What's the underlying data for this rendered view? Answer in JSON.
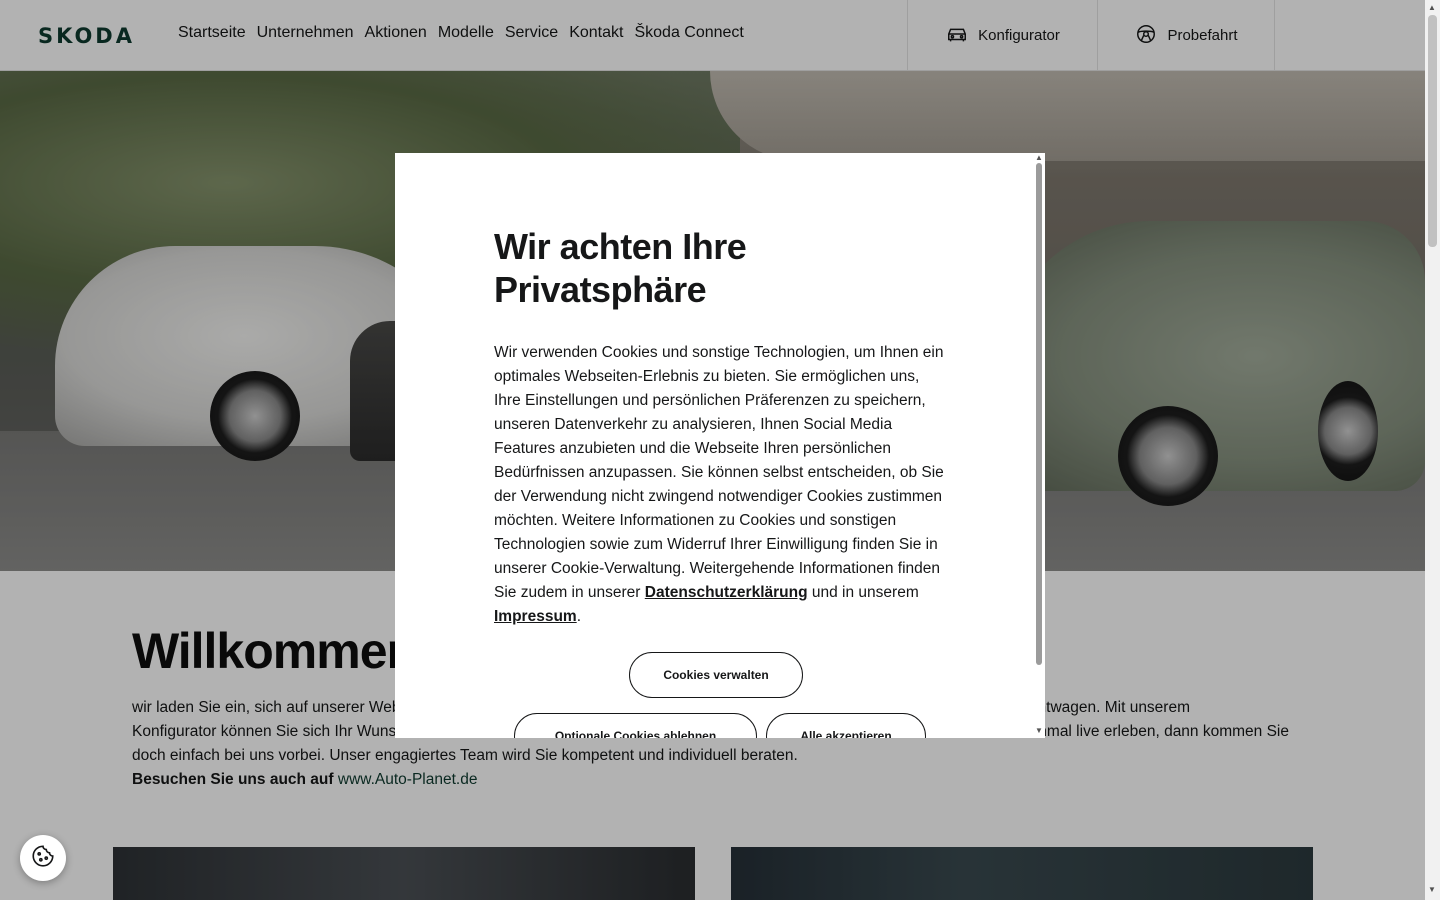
{
  "header": {
    "logo": "SKODA",
    "nav": [
      "Startseite",
      "Unternehmen",
      "Aktionen",
      "Modelle",
      "Service",
      "Kontakt",
      "Škoda Connect"
    ],
    "konfigurator_label": "Konfigurator",
    "probefahrt_label": "Probefahrt"
  },
  "main": {
    "welcome_title": "Willkommen",
    "intro_line1_start": "wir laden Sie ein, sich auf unserer Webs",
    "intro_line1_end": "uchtwagen. Mit unserem",
    "intro_line2_start": "Konfigurator können Sie sich Ihr Wunsc",
    "intro_line2_end": "nmal live erleben, dann kommen Sie",
    "intro_line3": "doch einfach bei uns vorbei. Unser engagiertes Team wird Sie kompetent und individuell beraten.",
    "visit_label": "Besuchen Sie uns auch auf",
    "visit_link": "www.Auto-Planet.de"
  },
  "cookie_modal": {
    "title": "Wir achten Ihre Privatsphäre",
    "body": "Wir verwenden Cookies und sonstige Technologien, um Ihnen ein optimales Webseiten-Erlebnis zu bieten. Sie ermöglichen uns, Ihre Einstellungen und persönlichen Präferenzen zu speichern, unseren Datenverkehr zu analysieren, Ihnen Social Media Features anzubieten und die Webseite Ihren persönlichen Bedürfnissen anzupassen. Sie können selbst entscheiden, ob Sie der Verwendung nicht zwingend notwendiger Cookies zustimmen möchten. Weitere Informationen zu Cookies und sonstigen Technologien sowie zum Widerruf Ihrer Einwilligung finden Sie in unserer Cookie-Verwaltung. Weitergehende Informationen finden Sie zudem in unserer",
    "privacy_link": "Datenschutzerklärung",
    "and_text": "und in unserem",
    "imprint_link": "Impressum",
    "period": ".",
    "manage_button": "Cookies verwalten",
    "reject_button": "Optionale Cookies ablehnen",
    "accept_button": "Alle akzeptieren"
  },
  "colors": {
    "brand_green": "#0e3a2f",
    "text": "#161718"
  },
  "icons": {
    "konfigurator": "car-icon",
    "probefahrt": "steering-wheel-icon",
    "cookie_settings": "cookie-icon"
  }
}
